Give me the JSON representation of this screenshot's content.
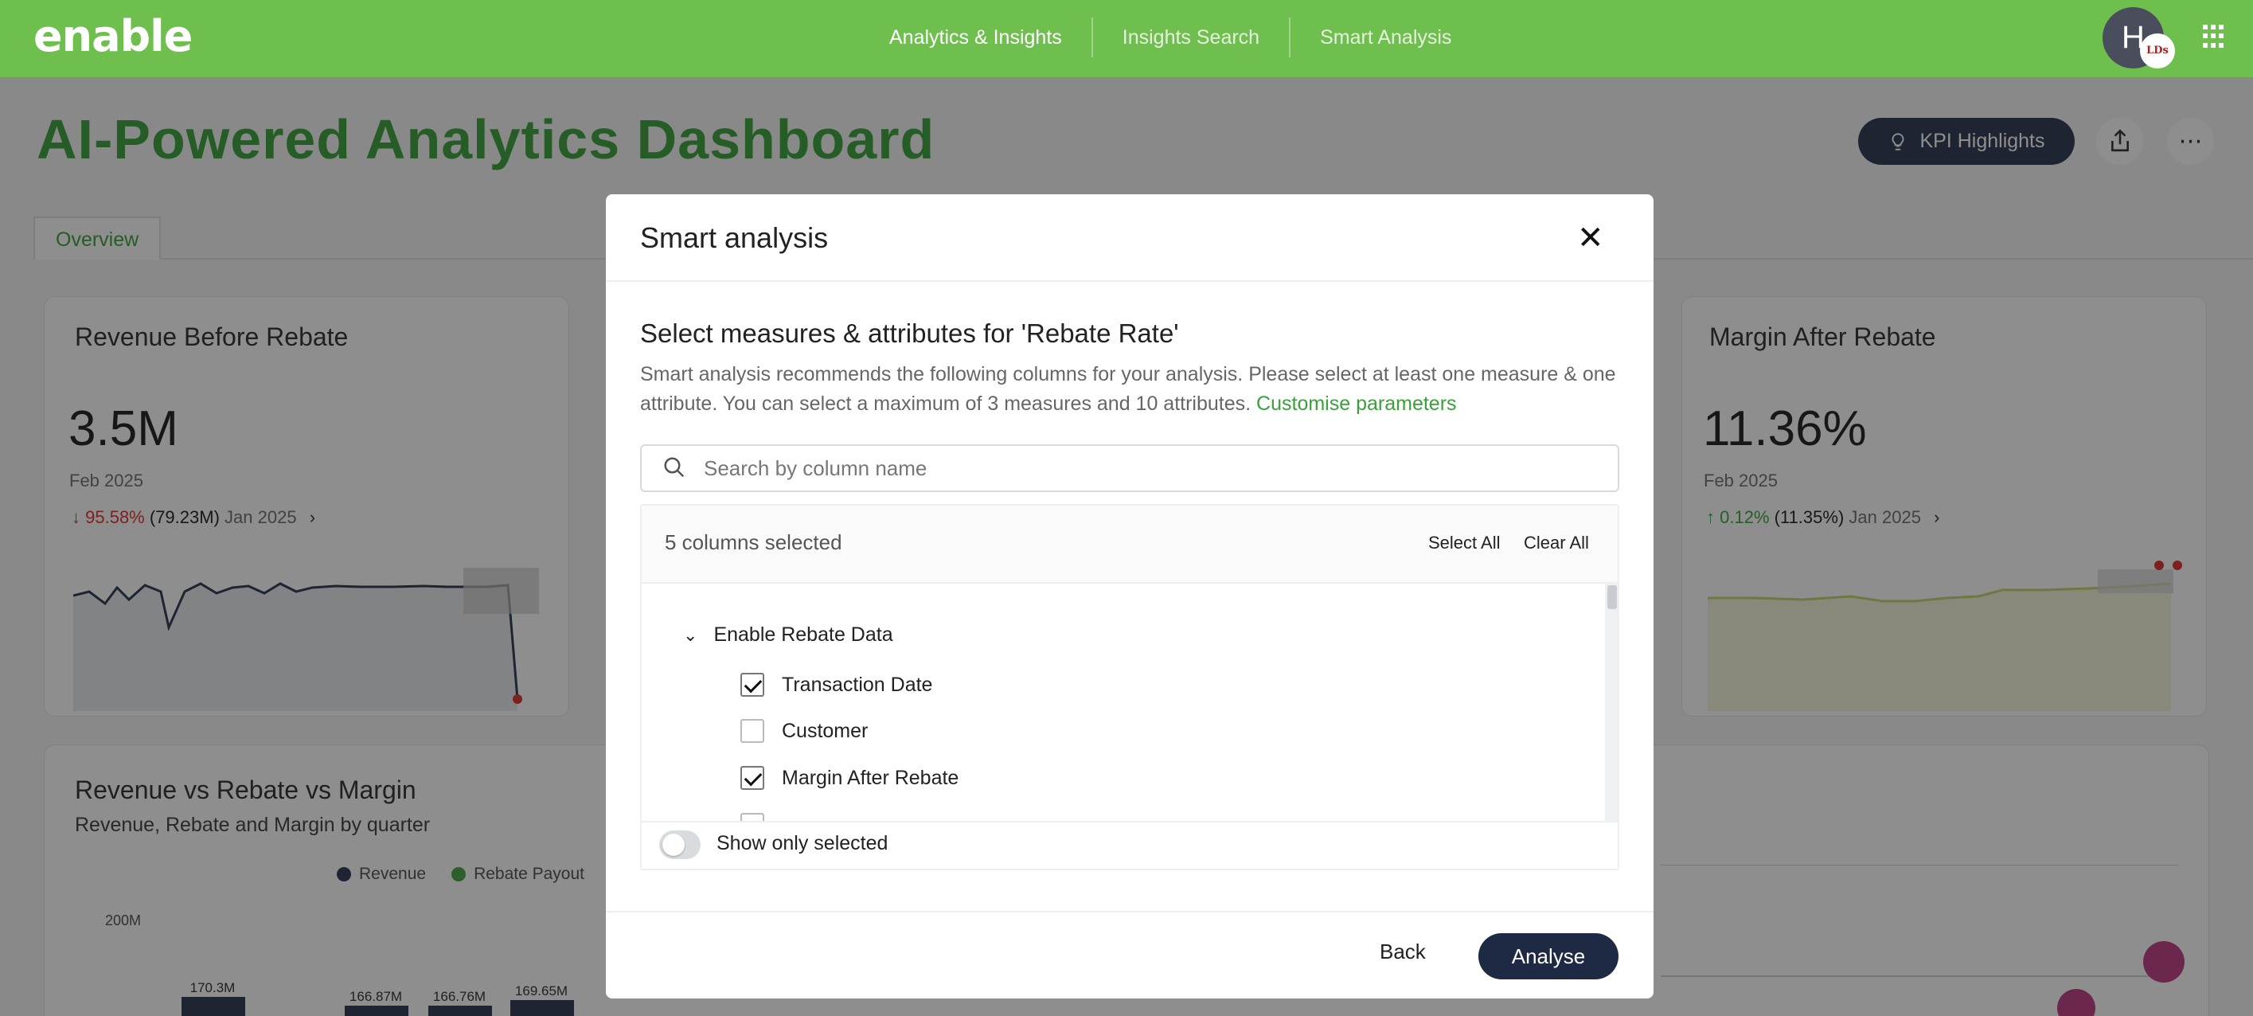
{
  "brand": {
    "logo_text": "enable",
    "accent": "#6fbf4f",
    "navy": "#1e2a44"
  },
  "nav": {
    "items": [
      "Analytics & Insights",
      "Insights Search",
      "Smart Analysis"
    ],
    "avatar_initial": "H",
    "avatar_badge": "LDs"
  },
  "page": {
    "title": "AI-Powered Analytics Dashboard",
    "kpi_button": "KPI Highlights",
    "tab": "Overview"
  },
  "cards": {
    "revenue": {
      "title": "Revenue Before Rebate",
      "value": "3.5M",
      "date": "Feb 2025",
      "delta_pct": "95.58%",
      "delta_abs": "(79.23M)",
      "delta_ref": "Jan 2025"
    },
    "margin": {
      "title": "Margin After Rebate",
      "value": "11.36%",
      "date": "Feb 2025",
      "delta_pct": "0.12%",
      "delta_abs": "(11.35%)",
      "delta_ref": "Jan 2025"
    },
    "rvr": {
      "title": "Revenue vs Rebate vs Margin",
      "subtitle": "Revenue, Rebate and Margin by quarter",
      "legend": [
        "Revenue",
        "Rebate Payout"
      ],
      "y_tick": "200M",
      "bar_labels": [
        "170.3M",
        "166.87M",
        "166.76M",
        "169.65M"
      ]
    }
  },
  "modal": {
    "title": "Smart analysis",
    "heading": "Select measures & attributes for 'Rebate Rate'",
    "description": "Smart analysis recommends the following columns for your analysis. Please select at least one measure & one attribute. You can select a maximum of 3 measures and 10 attributes.",
    "customise_link": "Customise parameters",
    "search_placeholder": "Search by column name",
    "columns_selected": "5 columns selected",
    "select_all": "Select All",
    "clear_all": "Clear All",
    "group": "Enable Rebate Data",
    "items": [
      {
        "label": "Transaction Date",
        "checked": true
      },
      {
        "label": "Customer",
        "checked": false
      },
      {
        "label": "Margin After Rebate",
        "checked": true
      }
    ],
    "show_only_selected": "Show only selected",
    "back": "Back",
    "analyse": "Analyse"
  }
}
